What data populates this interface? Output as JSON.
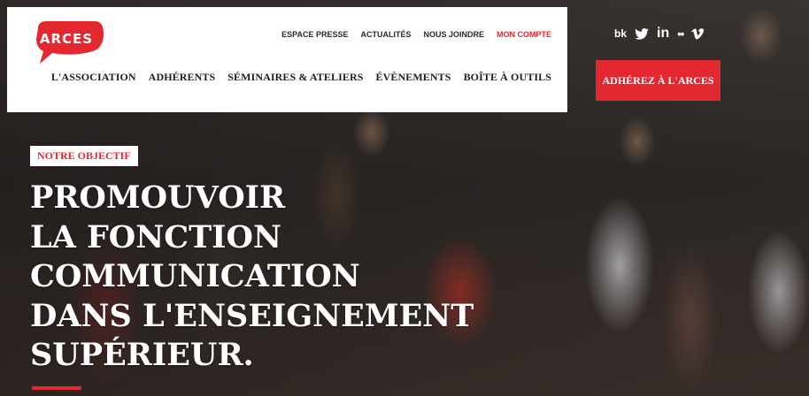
{
  "logo": {
    "text": "ARCES"
  },
  "top_nav": [
    {
      "label": "ESPACE PRESSE"
    },
    {
      "label": "ACTUALITÉS"
    },
    {
      "label": "NOUS JOINDRE"
    },
    {
      "label": "MON COMPTE"
    }
  ],
  "main_nav": [
    {
      "label": "L'ASSOCIATION"
    },
    {
      "label": "ADHÉRENTS"
    },
    {
      "label": "SÉMINAIRES & ATELIERS"
    },
    {
      "label": "ÉVÈNEMENTS"
    },
    {
      "label": "BOÎTE À OUTILS"
    }
  ],
  "social": {
    "vk": "bk",
    "linkedin": "in",
    "flickr": "••"
  },
  "cta": {
    "label": "ADHÉREZ À L'ARCES"
  },
  "hero": {
    "badge": "NOTRE OBJECTIF",
    "headline_lines": [
      "PROMOUVOIR",
      "LA FONCTION",
      "COMMUNICATION",
      "DANS L'ENSEIGNEMENT",
      "SUPÉRIEUR."
    ]
  },
  "colors": {
    "accent": "#e4282f",
    "text_dark": "#1f1f1f",
    "white": "#ffffff"
  }
}
